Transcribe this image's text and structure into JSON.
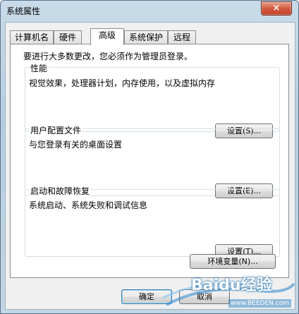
{
  "window": {
    "title": "系统属性",
    "close_symbol": "×"
  },
  "tabs": [
    {
      "label": "计算机名"
    },
    {
      "label": "硬件"
    },
    {
      "label": "高级"
    },
    {
      "label": "系统保护"
    },
    {
      "label": "远程"
    }
  ],
  "panel": {
    "notice": "要进行大多数更改，您必须作为管理员登录。",
    "performance": {
      "title": "性能",
      "description": "视觉效果，处理器计划，内存使用，以及虚拟内存",
      "button": "设置(S)..."
    },
    "user_profiles": {
      "title": "用户配置文件",
      "description": "与您登录有关的桌面设置",
      "button": "设置(E)..."
    },
    "startup_recovery": {
      "title": "启动和故障恢复",
      "description": "系统启动、系统失败和调试信息",
      "button": "设置(T)..."
    }
  },
  "env_button": "环境变量(N)...",
  "footer": {
    "ok": "确定",
    "cancel": "取消"
  },
  "watermark": {
    "text": "Baidu经验",
    "url": "www.BEEDEN.com"
  },
  "colors": {
    "titlebar": "#c3d6e3",
    "close_button": "#c7402a",
    "panel_bg": "#ffffff",
    "dialog_bg": "#f0f0f0"
  }
}
